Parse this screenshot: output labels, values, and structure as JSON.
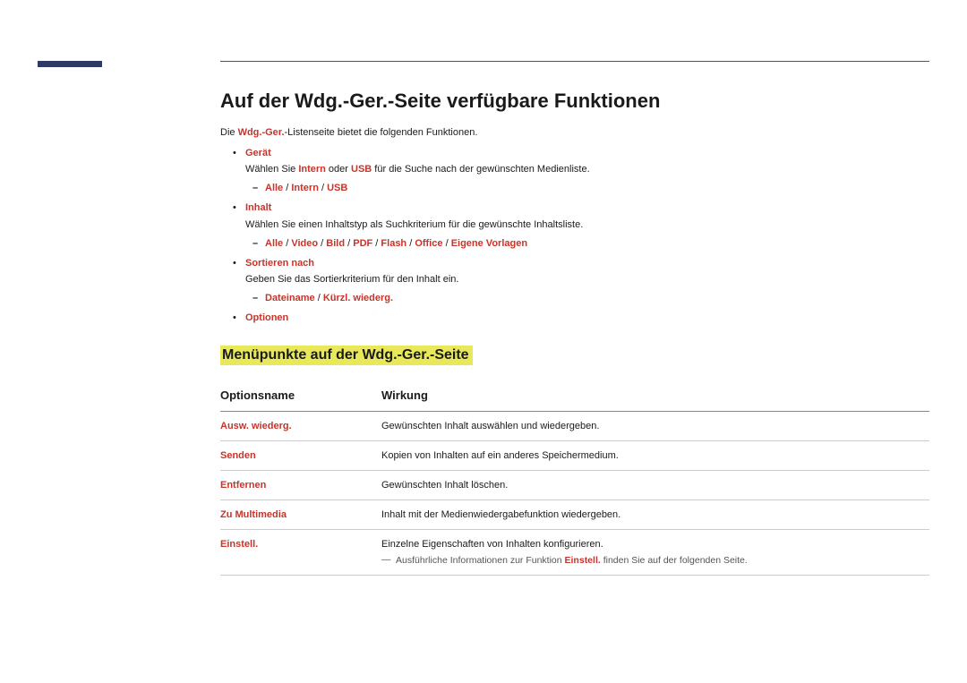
{
  "heading": "Auf der Wdg.-Ger.-Seite verfügbare Funktionen",
  "intro": {
    "prefix": "Die ",
    "bold": "Wdg.-Ger.",
    "suffix": "-Listenseite bietet die folgenden Funktionen."
  },
  "bullets": {
    "geraet": {
      "title": "Gerät",
      "desc_pre": "Wählen Sie ",
      "desc_b1": "Intern",
      "desc_mid": " oder ",
      "desc_b2": "USB",
      "desc_post": " für die Suche nach der gewünschten Medienliste.",
      "sub": {
        "o1": "Alle",
        "o2": "Intern",
        "o3": "USB"
      }
    },
    "inhalt": {
      "title": "Inhalt",
      "desc": "Wählen Sie einen Inhaltstyp als Suchkriterium für die gewünschte Inhaltsliste.",
      "sub": {
        "o1": "Alle",
        "o2": "Video",
        "o3": "Bild",
        "o4": "PDF",
        "o5": "Flash",
        "o6": "Office",
        "o7": "Eigene Vorlagen"
      }
    },
    "sortieren": {
      "title": "Sortieren nach",
      "desc": "Geben Sie das Sortierkriterium für den Inhalt ein.",
      "sub": {
        "o1": "Dateiname",
        "o2": "Kürzl. wiederg."
      }
    },
    "optionen": {
      "title": "Optionen"
    }
  },
  "subheading": "Menüpunkte auf der Wdg.-Ger.-Seite",
  "table": {
    "header": {
      "name": "Optionsname",
      "effect": "Wirkung"
    },
    "rows": {
      "r1": {
        "name": "Ausw. wiederg.",
        "effect": "Gewünschten Inhalt auswählen und wiedergeben."
      },
      "r2": {
        "name": "Senden",
        "effect": "Kopien von Inhalten auf ein anderes Speichermedium."
      },
      "r3": {
        "name": "Entfernen",
        "effect": "Gewünschten Inhalt löschen."
      },
      "r4": {
        "name": "Zu Multimedia",
        "effect": "Inhalt mit der Medienwiedergabefunktion wiedergeben."
      },
      "r5": {
        "name": "Einstell.",
        "effect": "Einzelne Eigenschaften von Inhalten konfigurieren.",
        "note_pre": "Ausführliche Informationen zur Funktion ",
        "note_bold": "Einstell.",
        "note_post": " finden Sie auf der folgenden Seite."
      }
    }
  }
}
